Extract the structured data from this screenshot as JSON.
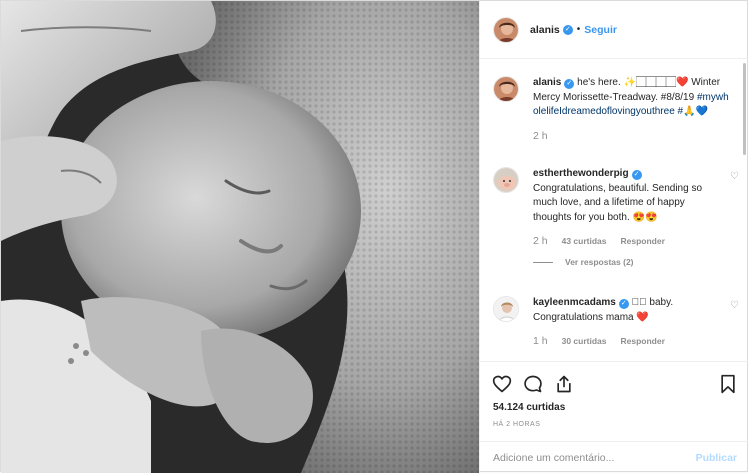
{
  "header": {
    "username": "alanis",
    "follow_label": "Seguir"
  },
  "caption": {
    "username": "alanis",
    "text": "he's here. ✨🏻🏻🏻🏻❤️ Winter Mercy Morissette-Treadway. #8/8/19",
    "hashtag": "#mywholelifeIdreamedoflovingyouthree #🙏💙",
    "time": "2 h"
  },
  "comments": [
    {
      "username": "estherthewonderpig",
      "text": "Congratulations, beautiful. Sending so much love, and a lifetime of happy thoughts for you both. 😍😍",
      "time": "2 h",
      "likes": "43 curtidas",
      "reply": "Responder",
      "view_replies": "Ver respostas (2)"
    },
    {
      "username": "kayleenmcadams",
      "text": "🏻🏻 baby. Congratulations mama ❤️",
      "time": "1 h",
      "likes": "30 curtidas",
      "reply": "Responder"
    }
  ],
  "actions": {
    "likes_count": "54.124 curtidas",
    "posted": "HÁ 2 HORAS"
  },
  "add_comment": {
    "placeholder": "Adicione um comentário...",
    "publish_label": "Publicar"
  },
  "icons": {
    "verified": "verified-badge-icon",
    "like": "heart-icon",
    "comment": "comment-bubble-icon",
    "share": "share-icon",
    "save": "bookmark-icon",
    "comment_like": "small-heart-icon"
  },
  "colors": {
    "link_blue": "#3897f0",
    "hashtag": "#003569",
    "secondary_text": "#8e8e8e",
    "publish_disabled": "#b3dbff"
  }
}
